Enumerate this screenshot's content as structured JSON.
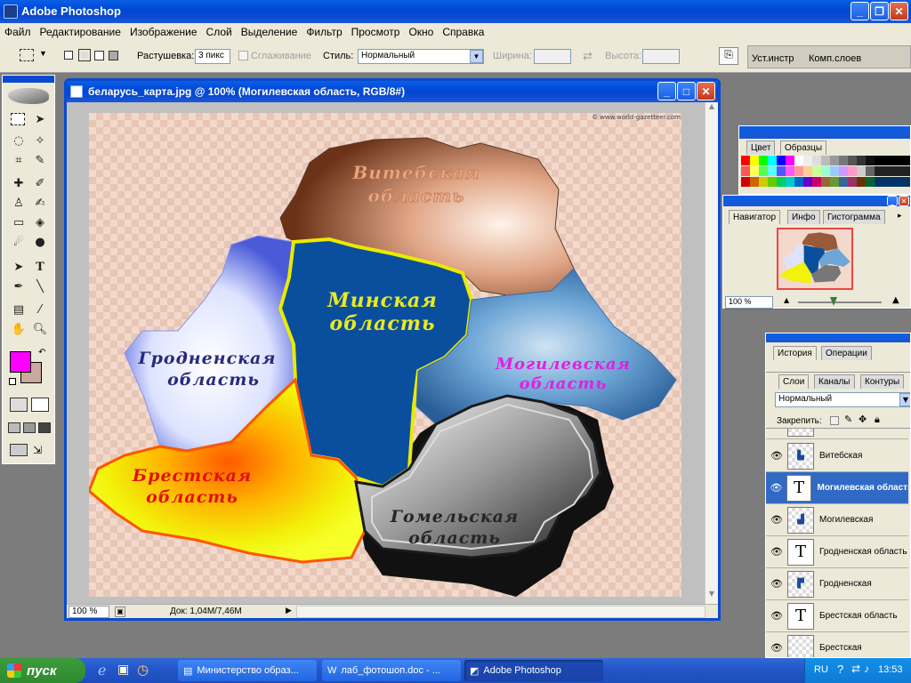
{
  "app": {
    "title": "Adobe Photoshop"
  },
  "menu": [
    "Файл",
    "Редактирование",
    "Изображение",
    "Слой",
    "Выделение",
    "Фильтр",
    "Просмотр",
    "Окно",
    "Справка"
  ],
  "options": {
    "feather_label": "Растушевка:",
    "feather_value": "3 пикс",
    "antialias_label": "Сглаживание",
    "style_label": "Стиль:",
    "style_value": "Нормальный",
    "width_label": "Ширина:",
    "height_label": "Высота:",
    "wells": [
      "Уст.инстр",
      "Комп.слоев"
    ]
  },
  "document": {
    "title": "беларусь_карта.jpg @ 100% (Могилевская область, RGB/8#)",
    "zoom": "100 %",
    "doc_size": "Док: 1,04М/7,46М",
    "watermark": "© www.world-gazetteer.com",
    "labels": {
      "vitebsk": [
        "Витебская",
        "область"
      ],
      "minsk": [
        "Минская",
        "область"
      ],
      "grodno": [
        "Гродненская",
        "область"
      ],
      "mogilev": [
        "Могилевская",
        "область"
      ],
      "brest": [
        "Брестская",
        "область"
      ],
      "gomel": [
        "Гомельская",
        "область"
      ]
    }
  },
  "swatches_panel": {
    "tabs": [
      "Цвет",
      "Образцы"
    ]
  },
  "navigator_panel": {
    "tabs": [
      "Навигатор",
      "Инфо",
      "Гистограмма"
    ],
    "zoom": "100 %"
  },
  "history_panel": {
    "tabs": [
      "История",
      "Операции"
    ]
  },
  "layers_panel": {
    "tabs": [
      "Слои",
      "Каналы",
      "Контуры"
    ],
    "blend_mode": "Нормальный",
    "lock_label": "Закрепить:",
    "layers": [
      {
        "name": "Витебская",
        "type": "pixel"
      },
      {
        "name": "Могилевская область",
        "type": "text",
        "selected": true
      },
      {
        "name": "Могилевская",
        "type": "pixel"
      },
      {
        "name": "Гродненская область",
        "type": "text"
      },
      {
        "name": "Гродненская",
        "type": "pixel"
      },
      {
        "name": "Брестская область",
        "type": "text"
      },
      {
        "name": "Брестская",
        "type": "pixel"
      }
    ]
  },
  "taskbar": {
    "start": "пуск",
    "windows": [
      "Министерство образ...",
      "лаб_фотошоп.doc - ...",
      "Adobe Photoshop"
    ],
    "lang": "RU",
    "time": "13:53"
  },
  "colors": {
    "fg": "#ff00ff",
    "bg": "#c8a99b",
    "title_blue": "#0a4ad0"
  }
}
